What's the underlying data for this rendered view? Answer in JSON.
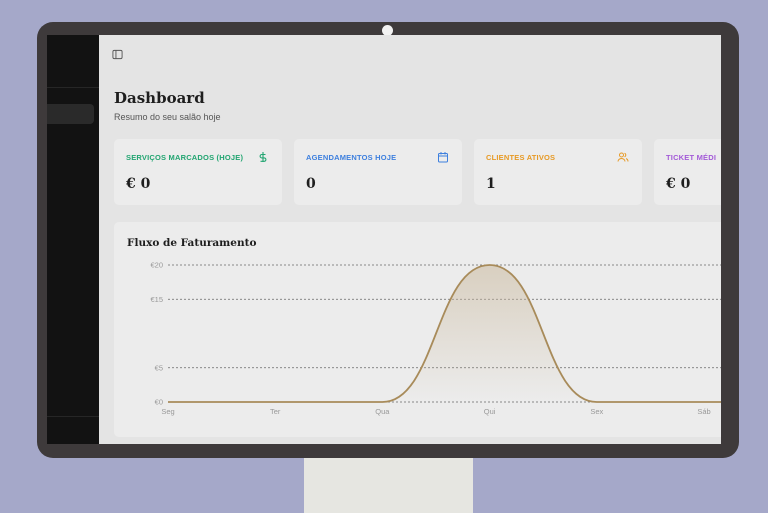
{
  "header": {
    "title": "Dashboard",
    "subtitle": "Resumo do seu salão hoje"
  },
  "cards": [
    {
      "label": "SERVIÇOS MARCADOS (HOJE)",
      "value": "€ 0",
      "color": "#22a571",
      "icon": "dollar-icon"
    },
    {
      "label": "AGENDAMENTOS HOJE",
      "value": "0",
      "color": "#3d7fde",
      "icon": "calendar-icon"
    },
    {
      "label": "CLIENTES ATIVOS",
      "value": "1",
      "color": "#e79a25",
      "icon": "users-icon"
    },
    {
      "label": "TICKET MÉDI",
      "value": "€ 0",
      "color": "#a35ad8",
      "icon": ""
    }
  ],
  "chart": {
    "title": "Fluxo de Faturamento"
  },
  "chart_data": {
    "type": "area",
    "title": "Fluxo de Faturamento",
    "categories": [
      "Seg",
      "Ter",
      "Qua",
      "Qui",
      "Sex",
      "Sáb"
    ],
    "values": [
      0,
      0,
      0,
      20,
      0,
      0
    ],
    "y_ticks": [
      "€0",
      "€5",
      "€15",
      "€20"
    ],
    "y_tick_values": [
      0,
      5,
      15,
      20
    ],
    "ylim": [
      0,
      20
    ],
    "grid": true,
    "colors": {
      "line": "#a88b5a",
      "fill": "#c9b89c"
    }
  }
}
